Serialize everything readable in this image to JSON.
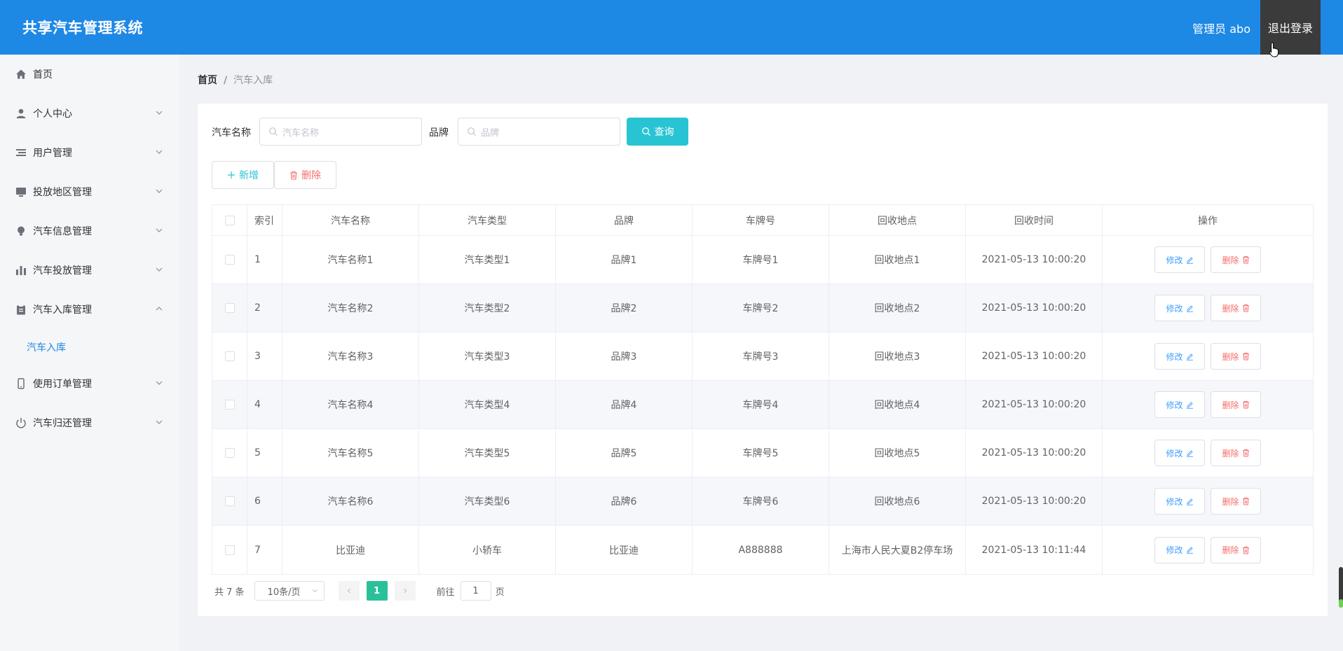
{
  "header": {
    "app_title": "共享汽车管理系统",
    "user_label": "管理员 abo",
    "logout_label": "退出登录"
  },
  "sidebar": {
    "items": [
      {
        "label": "首页",
        "icon": "home-icon",
        "has_chevron": false
      },
      {
        "label": "个人中心",
        "icon": "user-icon",
        "has_chevron": true
      },
      {
        "label": "用户管理",
        "icon": "list-icon",
        "has_chevron": true
      },
      {
        "label": "投放地区管理",
        "icon": "monitor-icon",
        "has_chevron": true
      },
      {
        "label": "汽车信息管理",
        "icon": "bulb-icon",
        "has_chevron": true
      },
      {
        "label": "汽车投放管理",
        "icon": "bar-chart-icon",
        "has_chevron": true
      },
      {
        "label": "汽车入库管理",
        "icon": "clipboard-icon",
        "has_chevron": true,
        "expanded": true
      },
      {
        "label": "使用订单管理",
        "icon": "phone-icon",
        "has_chevron": true
      },
      {
        "label": "汽车归还管理",
        "icon": "power-icon",
        "has_chevron": true
      }
    ],
    "sub_item": "汽车入库"
  },
  "breadcrumb": {
    "home": "首页",
    "separator": "/",
    "current": "汽车入库"
  },
  "search": {
    "name_label": "汽车名称",
    "name_placeholder": "汽车名称",
    "brand_label": "品牌",
    "brand_placeholder": "品牌",
    "query_label": "查询"
  },
  "actions": {
    "add_label": "新增",
    "delete_label": "删除"
  },
  "table": {
    "headers": [
      "索引",
      "汽车名称",
      "汽车类型",
      "品牌",
      "车牌号",
      "回收地点",
      "回收时间",
      "操作"
    ],
    "edit_label": "修改",
    "remove_label": "删除",
    "rows": [
      [
        "1",
        "汽车名称1",
        "汽车类型1",
        "品牌1",
        "车牌号1",
        "回收地点1",
        "2021-05-13 10:00:20"
      ],
      [
        "2",
        "汽车名称2",
        "汽车类型2",
        "品牌2",
        "车牌号2",
        "回收地点2",
        "2021-05-13 10:00:20"
      ],
      [
        "3",
        "汽车名称3",
        "汽车类型3",
        "品牌3",
        "车牌号3",
        "回收地点3",
        "2021-05-13 10:00:20"
      ],
      [
        "4",
        "汽车名称4",
        "汽车类型4",
        "品牌4",
        "车牌号4",
        "回收地点4",
        "2021-05-13 10:00:20"
      ],
      [
        "5",
        "汽车名称5",
        "汽车类型5",
        "品牌5",
        "车牌号5",
        "回收地点5",
        "2021-05-13 10:00:20"
      ],
      [
        "6",
        "汽车名称6",
        "汽车类型6",
        "品牌6",
        "车牌号6",
        "回收地点6",
        "2021-05-13 10:00:20"
      ],
      [
        "7",
        "比亚迪",
        "小轿车",
        "比亚迪",
        "A888888",
        "上海市人民大夏B2停车场",
        "2021-05-13 10:11:44"
      ]
    ]
  },
  "pagination": {
    "total": "共 7 条",
    "page_size": "10条/页",
    "current_page": "1",
    "goto_label": "前往",
    "goto_value": "1",
    "page_suffix": "页"
  },
  "colors": {
    "header": "#1e88e5",
    "query_button": "#29c4d3",
    "active_page": "#2ac19a",
    "danger": "#f56c6c"
  }
}
